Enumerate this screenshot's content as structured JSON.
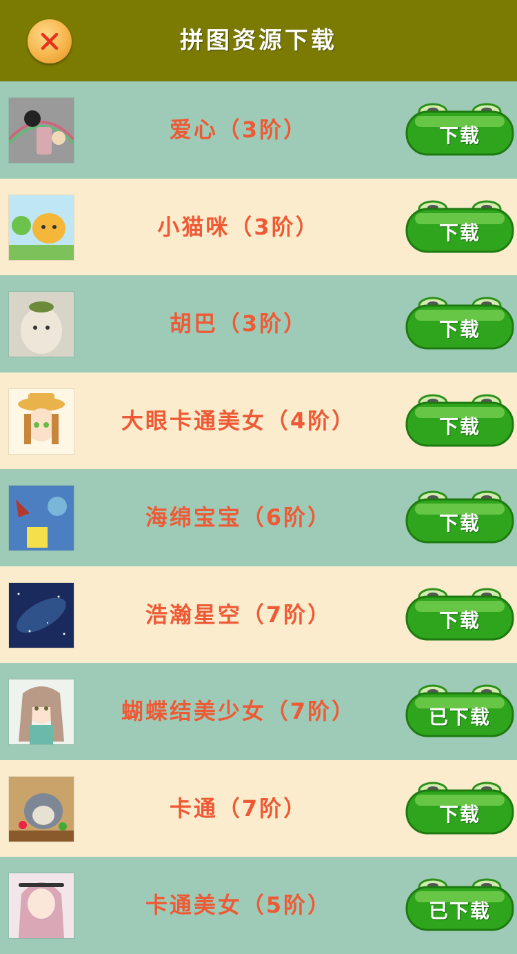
{
  "header": {
    "title": "拼图资源下载",
    "close_icon": "close-icon"
  },
  "colors": {
    "header_bg": "#7b7a02",
    "row_green": "#9dcbb8",
    "row_cream": "#faeccd",
    "label": "#ee5a35",
    "button_green": "#2fa51d"
  },
  "items": [
    {
      "label": "爱心（3阶）",
      "button": "下载"
    },
    {
      "label": "小猫咪（3阶）",
      "button": "下载"
    },
    {
      "label": "胡巴（3阶）",
      "button": "下载"
    },
    {
      "label": "大眼卡通美女（4阶）",
      "button": "下载"
    },
    {
      "label": "海绵宝宝（6阶）",
      "button": "下载"
    },
    {
      "label": "浩瀚星空（7阶）",
      "button": "下载"
    },
    {
      "label": "蝴蝶结美少女（7阶）",
      "button": "已下载"
    },
    {
      "label": "卡通（7阶）",
      "button": "下载"
    },
    {
      "label": "卡通美女（5阶）",
      "button": "已下载"
    }
  ]
}
